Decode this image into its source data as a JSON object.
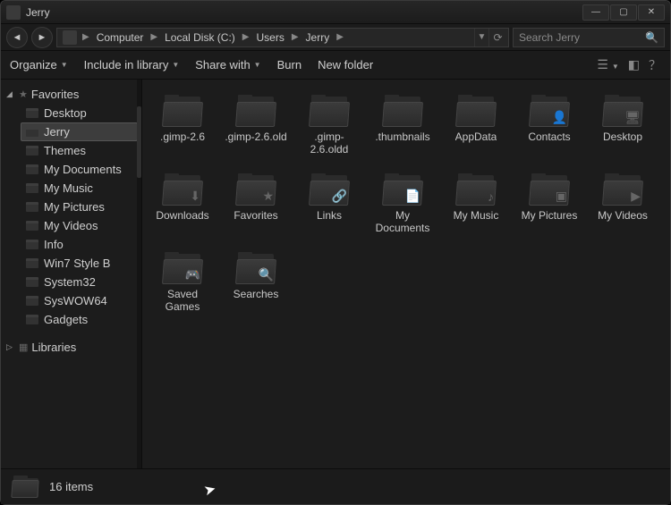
{
  "window": {
    "title": "Jerry"
  },
  "breadcrumb": [
    "Computer",
    "Local Disk (C:)",
    "Users",
    "Jerry"
  ],
  "search": {
    "placeholder": "Search Jerry"
  },
  "toolbar": {
    "organize": "Organize",
    "include": "Include in library",
    "share": "Share with",
    "burn": "Burn",
    "newfolder": "New folder"
  },
  "sidebar": {
    "favorites_header": "Favorites",
    "libraries_header": "Libraries",
    "favorites": [
      {
        "label": "Desktop"
      },
      {
        "label": "Jerry",
        "selected": true
      },
      {
        "label": "Themes"
      },
      {
        "label": "My Documents"
      },
      {
        "label": "My Music"
      },
      {
        "label": "My Pictures"
      },
      {
        "label": "My Videos"
      },
      {
        "label": "Info"
      },
      {
        "label": "Win7 Style B"
      },
      {
        "label": "System32"
      },
      {
        "label": "SysWOW64"
      },
      {
        "label": "Gadgets"
      }
    ]
  },
  "items": [
    {
      "label": ".gimp-2.6"
    },
    {
      "label": ".gimp-2.6.old"
    },
    {
      "label": ".gimp-2.6.oldd"
    },
    {
      "label": ".thumbnails"
    },
    {
      "label": "AppData"
    },
    {
      "label": "Contacts",
      "overlay": "👤"
    },
    {
      "label": "Desktop",
      "overlay": "🖥"
    },
    {
      "label": "Downloads",
      "overlay": "⬇"
    },
    {
      "label": "Favorites",
      "overlay": "★"
    },
    {
      "label": "Links",
      "overlay": "🔗"
    },
    {
      "label": "My Documents",
      "overlay": "📄"
    },
    {
      "label": "My Music",
      "overlay": "♪"
    },
    {
      "label": "My Pictures",
      "overlay": "▣"
    },
    {
      "label": "My Videos",
      "overlay": "▶"
    },
    {
      "label": "Saved Games",
      "overlay": "🎮"
    },
    {
      "label": "Searches",
      "overlay": "🔍"
    }
  ],
  "status": {
    "count_text": "16 items"
  }
}
